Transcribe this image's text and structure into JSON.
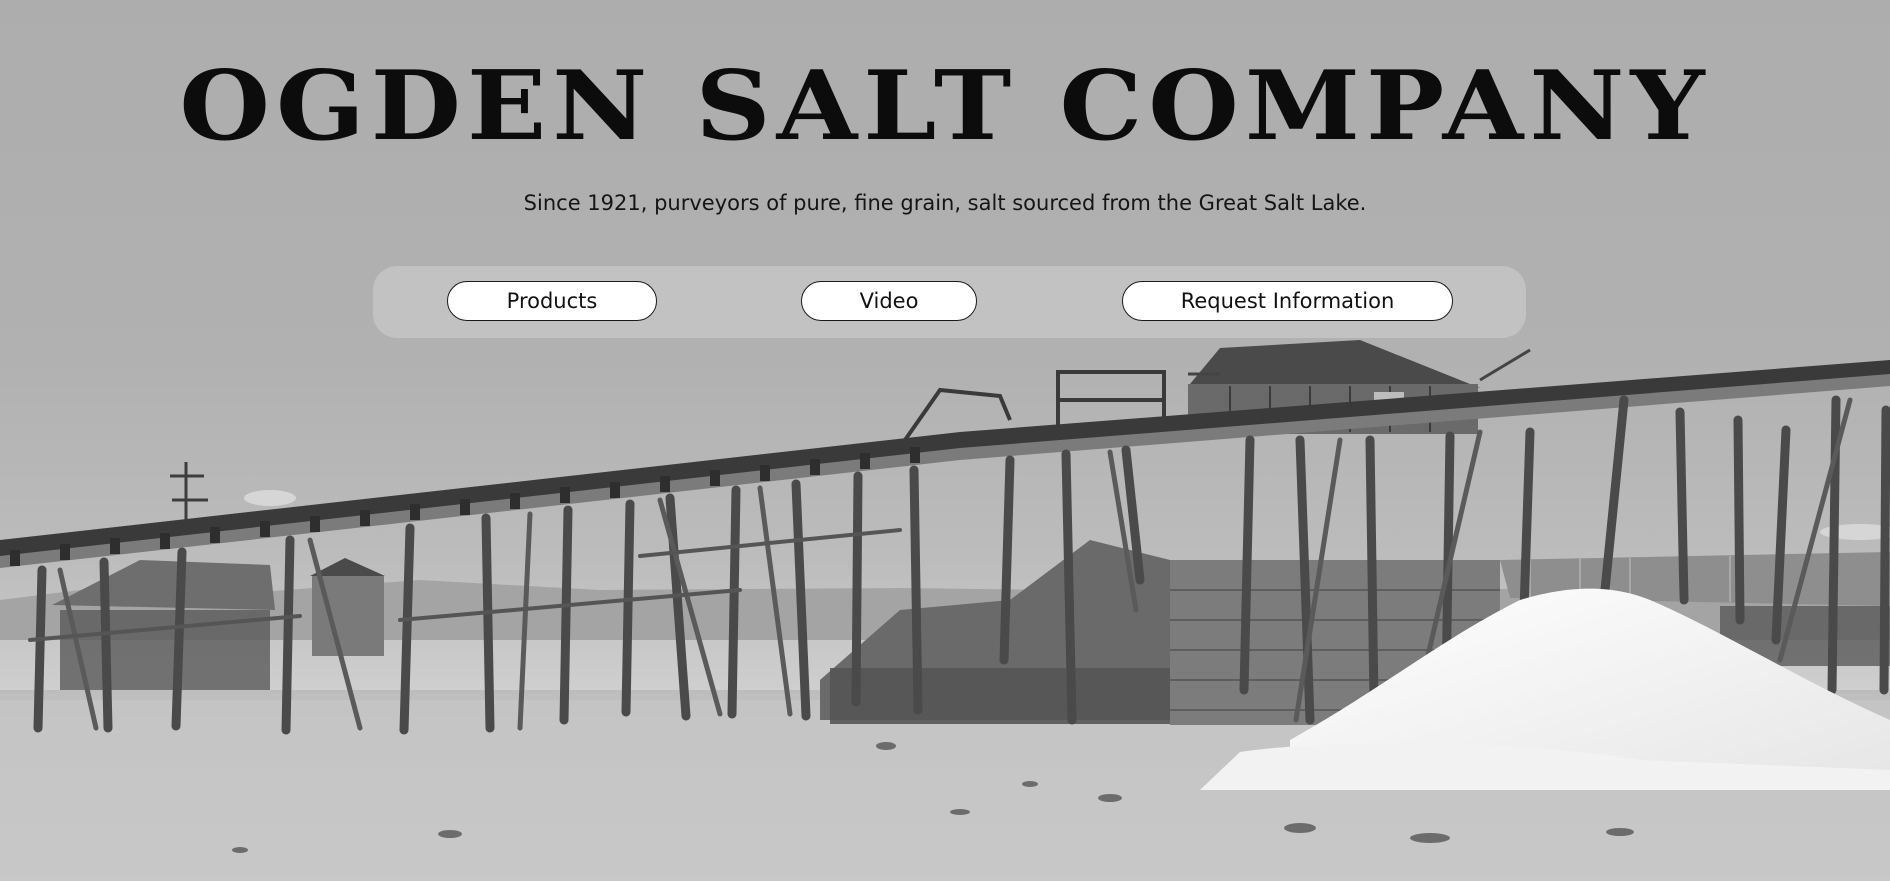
{
  "header": {
    "title": "OGDEN SALT COMPANY",
    "tagline": "Since 1921, purveyors of pure, fine grain, salt sourced from the Great Salt Lake."
  },
  "nav": {
    "items": [
      {
        "label": "Products"
      },
      {
        "label": "Video"
      },
      {
        "label": "Request Information"
      }
    ]
  },
  "hero": {
    "style": "grayscale photograph",
    "subject": "salt works trestle with salt pile"
  },
  "colors": {
    "sky": "#adadad",
    "nav_panel": "#cdcdcd",
    "button_bg": "#ffffff",
    "text": "#111111"
  }
}
